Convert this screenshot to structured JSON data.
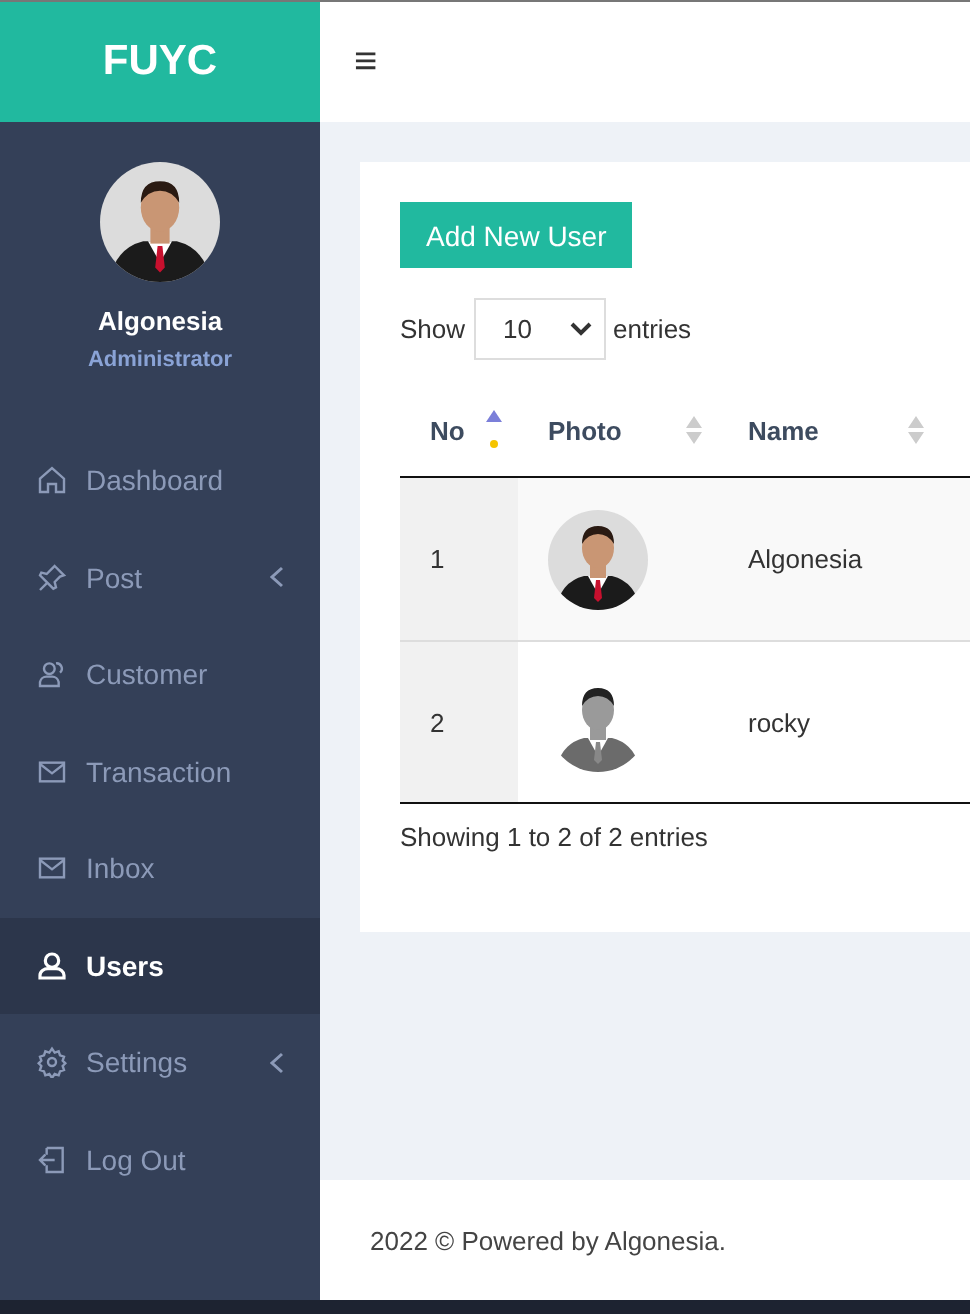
{
  "brand": "FUYC",
  "profile": {
    "name": "Algonesia",
    "role": "Administrator"
  },
  "menu": [
    {
      "label": "Dashboard",
      "kind": "home",
      "selected": false,
      "submenu": false
    },
    {
      "label": "Post",
      "kind": "pin",
      "selected": false,
      "submenu": true
    },
    {
      "label": "Customer",
      "kind": "users",
      "selected": false,
      "submenu": false
    },
    {
      "label": "Transaction",
      "kind": "mail",
      "selected": false,
      "submenu": false
    },
    {
      "label": "Inbox",
      "kind": "mail",
      "selected": false,
      "submenu": false
    },
    {
      "label": "Users",
      "kind": "user",
      "selected": true,
      "submenu": false
    },
    {
      "label": "Settings",
      "kind": "gear",
      "selected": false,
      "submenu": true
    },
    {
      "label": "Log Out",
      "kind": "logout",
      "selected": false,
      "submenu": false
    }
  ],
  "header": {
    "menu_glyph": "≡"
  },
  "add_button": "Add New User",
  "length": {
    "before": "Show",
    "value": "10",
    "after": "entries"
  },
  "table": {
    "columns": [
      {
        "label": "No",
        "sorted": true
      },
      {
        "label": "Photo",
        "sorted": false
      },
      {
        "label": "Name",
        "sorted": false
      }
    ],
    "rows": [
      {
        "no": "1",
        "name": "Algonesia"
      },
      {
        "no": "2",
        "name": "rocky"
      }
    ]
  },
  "info": "Showing 1 to 2 of 2 entries",
  "footer": "2022 © Powered by Algonesia."
}
